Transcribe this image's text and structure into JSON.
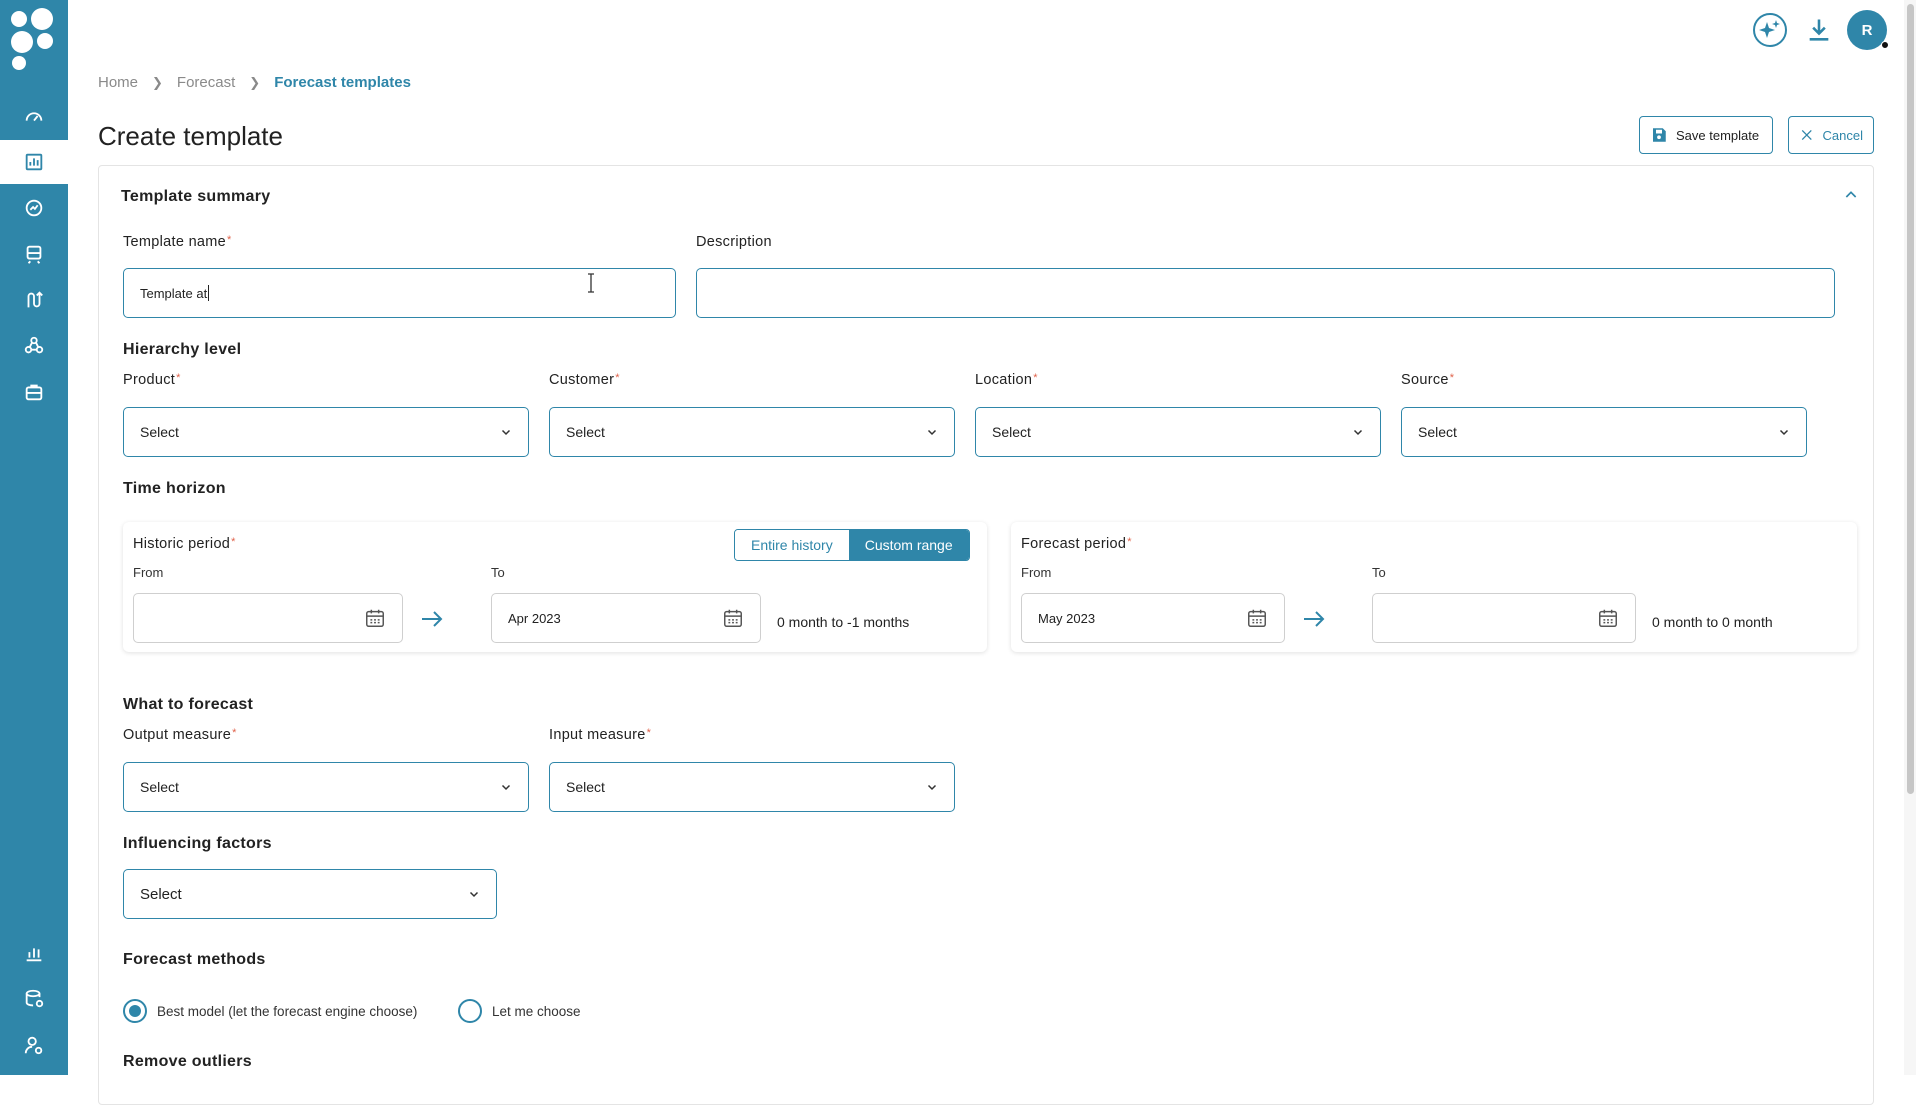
{
  "breadcrumb": {
    "home": "Home",
    "forecast": "Forecast",
    "current": "Forecast templates"
  },
  "page": {
    "title": "Create template"
  },
  "actions": {
    "save": "Save template",
    "cancel": "Cancel"
  },
  "user": {
    "initial": "R"
  },
  "summary": {
    "title": "Template summary",
    "template_name_label": "Template name",
    "template_name_value": "Template at",
    "description_label": "Description",
    "description_value": ""
  },
  "hierarchy": {
    "title": "Hierarchy level",
    "product": {
      "label": "Product",
      "value": "Select"
    },
    "customer": {
      "label": "Customer",
      "value": "Select"
    },
    "location": {
      "label": "Location",
      "value": "Select"
    },
    "source": {
      "label": "Source",
      "value": "Select"
    }
  },
  "time_horizon": {
    "title": "Time horizon",
    "historic": {
      "label": "Historic period",
      "from_label": "From",
      "from_value": "",
      "to_label": "To",
      "to_value": "Apr 2023",
      "range": "0 month to -1 months",
      "toggle_entire": "Entire history",
      "toggle_custom": "Custom range",
      "selected_mode": "Custom range"
    },
    "forecast": {
      "label": "Forecast period",
      "from_label": "From",
      "from_value": "May 2023",
      "to_label": "To",
      "to_value": "",
      "range": "0 month to 0 month"
    }
  },
  "what_to_forecast": {
    "title": "What to forecast",
    "output": {
      "label": "Output measure",
      "value": "Select"
    },
    "input": {
      "label": "Input measure",
      "value": "Select"
    }
  },
  "influencing": {
    "title": "Influencing factors",
    "value": "Select"
  },
  "methods": {
    "title": "Forecast methods",
    "options": [
      "Best model (let the forecast engine choose)",
      "Let me choose"
    ],
    "selected": "Best model (let the forecast engine choose)"
  },
  "outliers": {
    "title": "Remove outliers"
  },
  "colors": {
    "brand": "#2f86a9",
    "required": "#e0624a"
  },
  "icons": {
    "sidebar": [
      "dashboard-icon",
      "report-chart-icon",
      "trend-icon",
      "train-icon",
      "route-icon",
      "network-icon",
      "briefcase-icon",
      "bar-chart-icon",
      "database-settings-icon",
      "user-settings-icon"
    ],
    "topbar": [
      "ai-sparkle-icon",
      "download-icon"
    ]
  }
}
